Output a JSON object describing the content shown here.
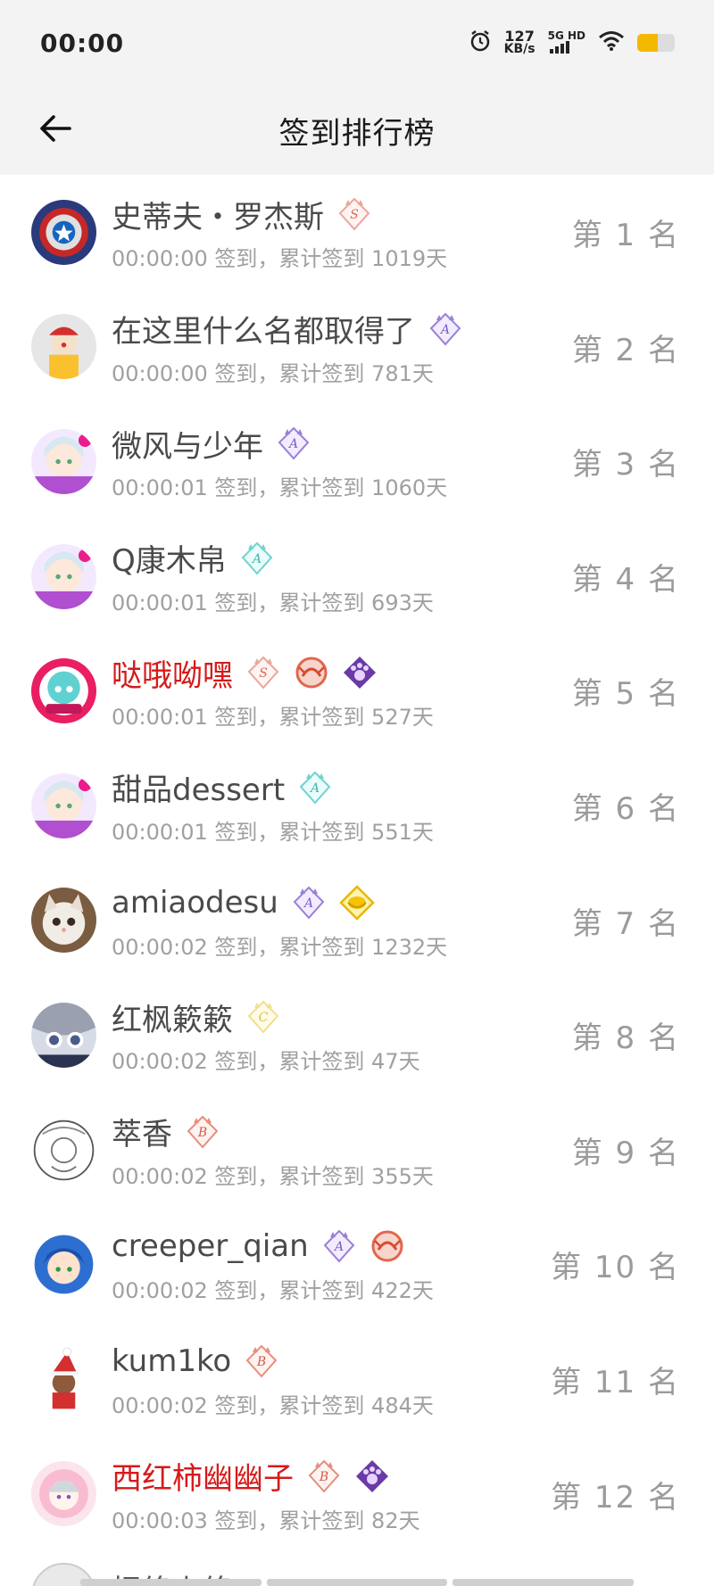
{
  "status_bar": {
    "time": "00:00",
    "net_speed_value": "127",
    "net_speed_unit": "KB/s",
    "network_type_top": "5G HD",
    "battery_color": "#f5b800",
    "icons": [
      "alarm-icon",
      "signal-icon",
      "wifi-icon",
      "battery-icon"
    ]
  },
  "header": {
    "title": "签到排行榜",
    "back_icon": "arrow-left-icon"
  },
  "colors": {
    "normal_name": "#4a4a4a",
    "highlight_name": "#d61a1a",
    "meta": "#a0a0a0",
    "rank": "#9b9b9b"
  },
  "entries": [
    {
      "name": "史蒂夫・罗杰斯",
      "meta": "00:00:00 签到，累计签到 1019天",
      "rank": "第 1 名",
      "highlight": false,
      "avatar": "captain-america-avatar",
      "badges": [
        "level-s-badge"
      ]
    },
    {
      "name": "在这里什么名都取得了",
      "meta": "00:00:00 签到，累计签到 781天",
      "rank": "第 2 名",
      "highlight": false,
      "avatar": "clown-avatar",
      "badges": [
        "level-a-purple-badge"
      ]
    },
    {
      "name": "微风与少年",
      "meta": "00:00:01 签到，累计签到 1060天",
      "rank": "第 3 名",
      "highlight": false,
      "avatar": "anime-girl-avatar",
      "badges": [
        "level-a-purple-badge"
      ]
    },
    {
      "name": "Q康木帛",
      "meta": "00:00:01 签到，累计签到 693天",
      "rank": "第 4 名",
      "highlight": false,
      "avatar": "anime-girl-avatar",
      "badges": [
        "level-a-teal-badge"
      ]
    },
    {
      "name": "哒哦呦嘿",
      "meta": "00:00:01 签到，累计签到 527天",
      "rank": "第 5 名",
      "highlight": true,
      "avatar": "miku-avatar",
      "badges": [
        "level-s-badge",
        "red-emblem-badge",
        "purple-paw-badge"
      ]
    },
    {
      "name": "甜品dessert",
      "meta": "00:00:01 签到，累计签到 551天",
      "rank": "第 6 名",
      "highlight": false,
      "avatar": "anime-girl-avatar",
      "badges": [
        "level-a-teal-badge"
      ]
    },
    {
      "name": "amiaodesu",
      "meta": "00:00:02 签到，累计签到 1232天",
      "rank": "第 7 名",
      "highlight": false,
      "avatar": "cat-avatar",
      "badges": [
        "level-a-purple-badge",
        "gold-emblem-badge"
      ]
    },
    {
      "name": "红枫簌簌",
      "meta": "00:00:02 签到，累计签到 47天",
      "rank": "第 8 名",
      "highlight": false,
      "avatar": "anime-eyes-avatar",
      "badges": [
        "level-c-badge"
      ]
    },
    {
      "name": "萃香",
      "meta": "00:00:02 签到，累计签到 355天",
      "rank": "第 9 名",
      "highlight": false,
      "avatar": "sketch-avatar",
      "badges": [
        "level-b-badge"
      ]
    },
    {
      "name": "creeper_qian",
      "meta": "00:00:02 签到，累计签到 422天",
      "rank": "第 10 名",
      "highlight": false,
      "avatar": "blue-hair-avatar",
      "badges": [
        "level-a-purple-badge",
        "red-emblem-badge"
      ]
    },
    {
      "name": "kum1ko",
      "meta": "00:00:02 签到，累计签到 484天",
      "rank": "第 11 名",
      "highlight": false,
      "avatar": "santa-avatar",
      "badges": [
        "level-b-badge"
      ]
    },
    {
      "name": "西红柿幽幽子",
      "meta": "00:00:03 签到，累计签到 82天",
      "rank": "第 12 名",
      "highlight": true,
      "avatar": "pink-anime-avatar",
      "badges": [
        "level-b-badge",
        "purple-paw-badge"
      ]
    }
  ],
  "partial_entry": {
    "name": "择终上终"
  }
}
